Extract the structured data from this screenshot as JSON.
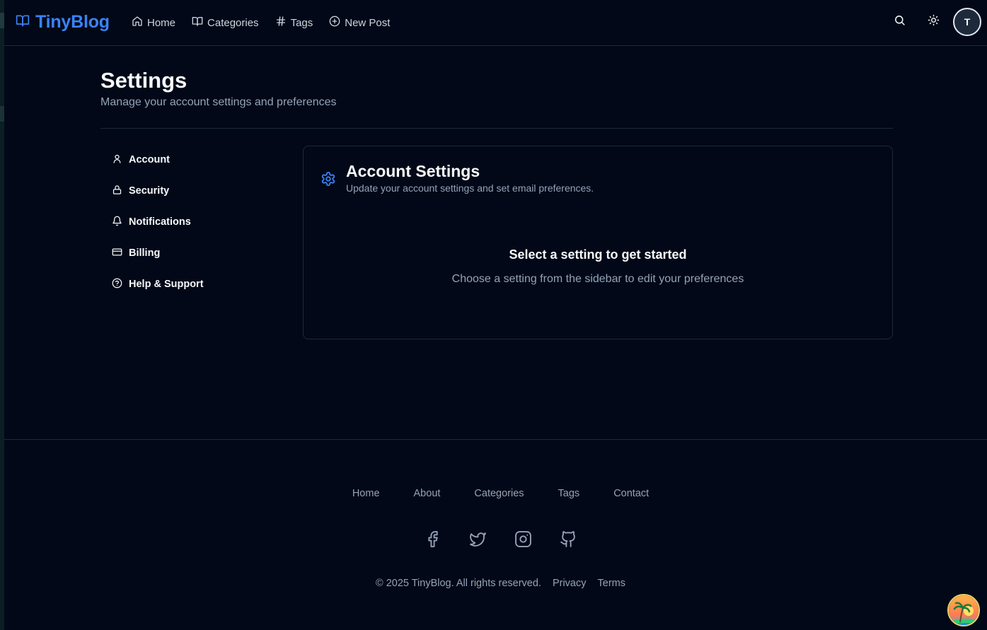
{
  "header": {
    "brand": "TinyBlog",
    "nav": [
      {
        "label": "Home",
        "icon": "home-icon"
      },
      {
        "label": "Categories",
        "icon": "book-open-icon"
      },
      {
        "label": "Tags",
        "icon": "hash-icon"
      },
      {
        "label": "New Post",
        "icon": "plus-circle-icon"
      }
    ],
    "avatar_initial": "T"
  },
  "page": {
    "title": "Settings",
    "subtitle": "Manage your account settings and preferences"
  },
  "sidebar": {
    "items": [
      {
        "label": "Account",
        "icon": "user-icon"
      },
      {
        "label": "Security",
        "icon": "lock-icon"
      },
      {
        "label": "Notifications",
        "icon": "bell-icon"
      },
      {
        "label": "Billing",
        "icon": "credit-card-icon"
      },
      {
        "label": "Help & Support",
        "icon": "help-circle-icon"
      }
    ]
  },
  "card": {
    "title": "Account Settings",
    "description": "Update your account settings and set email preferences.",
    "empty_title": "Select a setting to get started",
    "empty_description": "Choose a setting from the sidebar to edit your preferences"
  },
  "footer": {
    "links": [
      "Home",
      "About",
      "Categories",
      "Tags",
      "Contact"
    ],
    "social": [
      "facebook-icon",
      "twitter-icon",
      "instagram-icon",
      "github-icon"
    ],
    "copyright": "© 2025 TinyBlog. All rights reserved.",
    "privacy": "Privacy",
    "terms": "Terms"
  },
  "colors": {
    "background": "#020817",
    "accent": "#3b82f6",
    "muted_text": "#94a3b8",
    "border": "#1e293b"
  }
}
